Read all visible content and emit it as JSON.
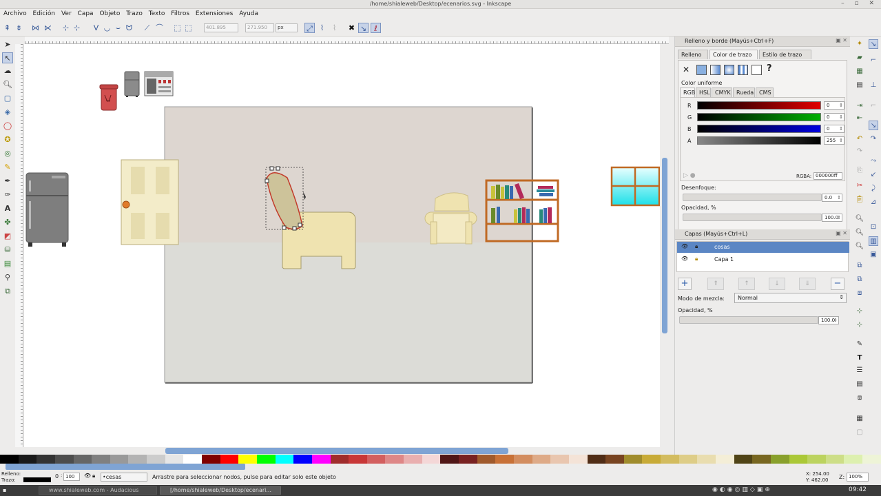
{
  "window": {
    "title": "/home/shialeweb/Desktop/ecenarios.svg - Inkscape"
  },
  "menu": [
    "Archivo",
    "Edición",
    "Ver",
    "Capa",
    "Objeto",
    "Trazo",
    "Texto",
    "Filtros",
    "Extensiones",
    "Ayuda"
  ],
  "toolbar": {
    "x_value": "401.895",
    "y_value": "271.950",
    "unit": "px"
  },
  "fill_stroke": {
    "title": "Relleno y borde (Mayús+Ctrl+F)",
    "tabs": [
      "Relleno",
      "Color de trazo",
      "Estilo de trazo"
    ],
    "mode_label": "Color uniforme",
    "color_tabs": [
      "RGB",
      "HSL",
      "CMYK",
      "Rueda",
      "CMS"
    ],
    "channels": [
      {
        "name": "R",
        "value": "0",
        "color": "#e00000"
      },
      {
        "name": "G",
        "value": "0",
        "color": "#00b000"
      },
      {
        "name": "B",
        "value": "0",
        "color": "#0000e0"
      },
      {
        "name": "A",
        "value": "255",
        "color": "#000000"
      }
    ],
    "rgba_label": "RGBA:",
    "rgba_value": "000000ff",
    "blur_label": "Desenfoque:",
    "blur_value": "0.0",
    "opacity_label": "Opacidad, %",
    "opacity_value": "100.0"
  },
  "layers": {
    "title": "Capas (Mayús+Ctrl+L)",
    "items": [
      {
        "name": "cosas",
        "selected": true
      },
      {
        "name": "Capa 1",
        "selected": false
      }
    ],
    "blend_label": "Modo de mezcla:",
    "blend_value": "Normal",
    "opacity_label": "Opacidad, %",
    "opacity_value": "100.0"
  },
  "status": {
    "fill_label": "Relleno:",
    "stroke_label": "Trazo:",
    "stroke_width": "0",
    "opacity": "100",
    "layer": "•cesas",
    "message": "Arrastre para seleccionar nodos, pulse para editar solo este objeto",
    "x_coord": "X: 254.00",
    "y_coord": "Y: 462.00",
    "zoom_label": "Z:",
    "zoom": "100%"
  },
  "taskbar": {
    "items": [
      "www.shialeweb.com - Audacious",
      "[/home/shialeweb/Desktop/ecenari..."
    ],
    "clock": "09:42"
  },
  "colors": {
    "accent": "#4a78c2",
    "selected_layer": "#5b86c4",
    "wall": "#ddd6d0",
    "floor": "#dcdcd7",
    "cream": "#efe3b0"
  }
}
